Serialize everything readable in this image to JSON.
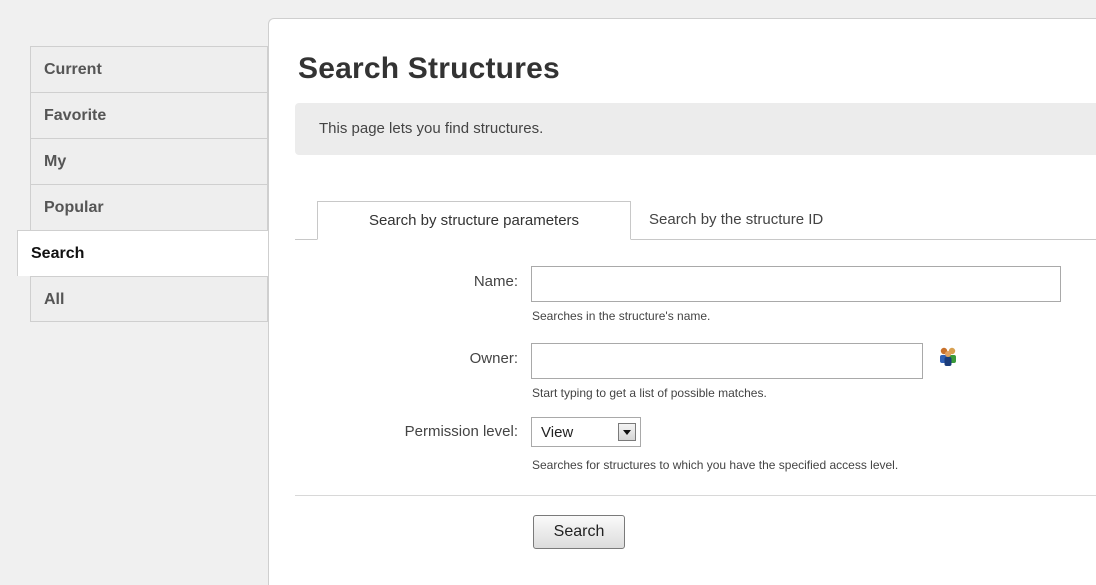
{
  "sidebar": {
    "items": [
      {
        "label": "Current"
      },
      {
        "label": "Favorite"
      },
      {
        "label": "My"
      },
      {
        "label": "Popular"
      },
      {
        "label": "Search"
      },
      {
        "label": "All"
      }
    ],
    "active": "Search"
  },
  "main": {
    "title": "Search Structures",
    "info": "This page lets you find structures.",
    "tabs": [
      {
        "label": "Search by structure parameters"
      },
      {
        "label": "Search by the structure ID"
      }
    ],
    "active_tab": "Search by structure parameters"
  },
  "form": {
    "name": {
      "label": "Name:",
      "value": "",
      "hint": "Searches in the structure's name."
    },
    "owner": {
      "label": "Owner:",
      "value": "",
      "hint": "Start typing to get a list of possible matches.",
      "picker_icon": "users-icon"
    },
    "permission": {
      "label": "Permission level:",
      "selected": "View",
      "hint": "Searches for structures to which you have the specified access level."
    },
    "submit_label": "Search"
  },
  "colors": {
    "page_background": "#f0f0f0",
    "panel_background": "#ffffff",
    "info_background": "#ececec",
    "border": "#cfcfcf"
  }
}
